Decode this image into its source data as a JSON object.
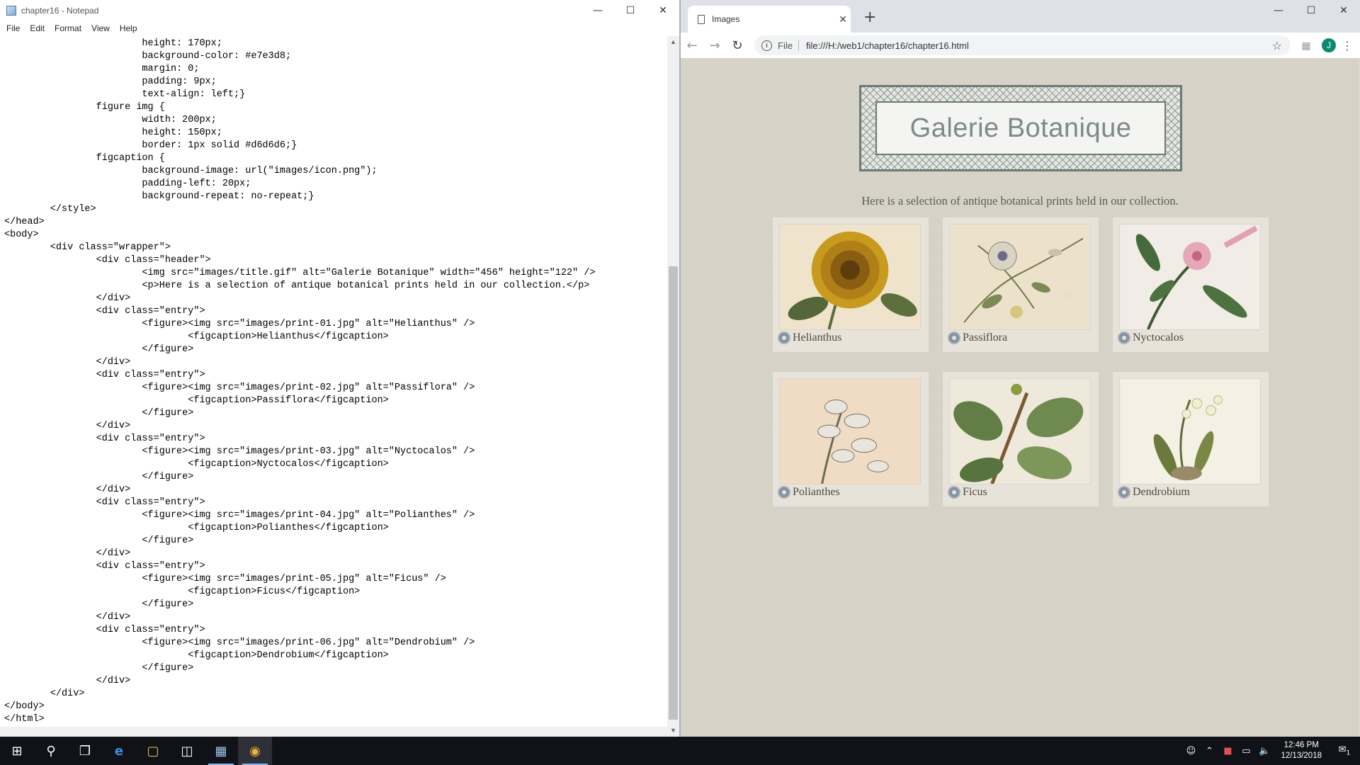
{
  "notepad": {
    "title": "chapter16 - Notepad",
    "menu": [
      "File",
      "Edit",
      "Format",
      "View",
      "Help"
    ],
    "code": "                        height: 170px;\n                        background-color: #e7e3d8;\n                        margin: 0;\n                        padding: 9px;\n                        text-align: left;}\n                figure img {\n                        width: 200px;\n                        height: 150px;\n                        border: 1px solid #d6d6d6;}\n                figcaption {\n                        background-image: url(\"images/icon.png\");\n                        padding-left: 20px;\n                        background-repeat: no-repeat;}\n        </style>\n</head>\n<body>\n        <div class=\"wrapper\">\n                <div class=\"header\">\n                        <img src=\"images/title.gif\" alt=\"Galerie Botanique\" width=\"456\" height=\"122\" />\n                        <p>Here is a selection of antique botanical prints held in our collection.</p>\n                </div>\n                <div class=\"entry\">\n                        <figure><img src=\"images/print-01.jpg\" alt=\"Helianthus\" />\n                                <figcaption>Helianthus</figcaption>\n                        </figure>\n                </div>\n                <div class=\"entry\">\n                        <figure><img src=\"images/print-02.jpg\" alt=\"Passiflora\" />\n                                <figcaption>Passiflora</figcaption>\n                        </figure>\n                </div>\n                <div class=\"entry\">\n                        <figure><img src=\"images/print-03.jpg\" alt=\"Nyctocalos\" />\n                                <figcaption>Nyctocalos</figcaption>\n                        </figure>\n                </div>\n                <div class=\"entry\">\n                        <figure><img src=\"images/print-04.jpg\" alt=\"Polianthes\" />\n                                <figcaption>Polianthes</figcaption>\n                        </figure>\n                </div>\n                <div class=\"entry\">\n                        <figure><img src=\"images/print-05.jpg\" alt=\"Ficus\" />\n                                <figcaption>Ficus</figcaption>\n                        </figure>\n                </div>\n                <div class=\"entry\">\n                        <figure><img src=\"images/print-06.jpg\" alt=\"Dendrobium\" />\n                                <figcaption>Dendrobium</figcaption>\n                        </figure>\n                </div>\n        </div>\n</body>\n</html>"
  },
  "chrome": {
    "tab_title": "Images",
    "scheme_label": "File",
    "url": "file:///H:/web1/chapter16/chapter16.html",
    "avatar_letter": "J",
    "accent": "#0b8a6e"
  },
  "page": {
    "banner_title": "Galerie Botanique",
    "intro": "Here is a selection of antique botanical prints held in our collection.",
    "background": "#d5d1c5",
    "entry_background": "#e7e3d8",
    "entries": [
      {
        "caption": "Helianthus",
        "icon": "sunflower-print"
      },
      {
        "caption": "Passiflora",
        "icon": "passionflower-print"
      },
      {
        "caption": "Nyctocalos",
        "icon": "pink-flower-print"
      },
      {
        "caption": "Polianthes",
        "icon": "tuberose-print"
      },
      {
        "caption": "Ficus",
        "icon": "ficus-leaves-print"
      },
      {
        "caption": "Dendrobium",
        "icon": "orchid-print"
      }
    ]
  },
  "taskbar": {
    "apps": [
      "start-icon",
      "search-icon",
      "task-view-icon",
      "edge-icon",
      "file-explorer-icon",
      "store-icon",
      "notepad-icon",
      "chrome-icon"
    ],
    "time": "12:46 PM",
    "date": "12/13/2018",
    "notification_count": "1"
  }
}
